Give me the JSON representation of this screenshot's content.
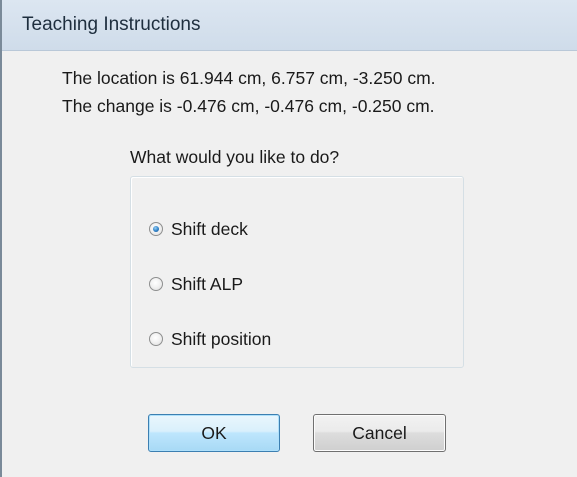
{
  "window": {
    "title": "Teaching Instructions"
  },
  "info": {
    "location_line": "The location is 61.944 cm, 6.757 cm, -3.250 cm.",
    "change_line": "The change is -0.476 cm, -0.476 cm, -0.250 cm."
  },
  "options": {
    "prompt": "What would you like to do?",
    "items": [
      {
        "label": "Shift deck",
        "selected": true
      },
      {
        "label": "Shift ALP",
        "selected": false
      },
      {
        "label": "Shift position",
        "selected": false
      }
    ]
  },
  "buttons": {
    "ok_label": "OK",
    "cancel_label": "Cancel"
  },
  "colors": {
    "title_bar": "#d6e2ee",
    "dialog_body": "#f0f0f0",
    "default_button_border": "#3c7fb1",
    "radio_selected_dot": "#2c7fc6"
  }
}
